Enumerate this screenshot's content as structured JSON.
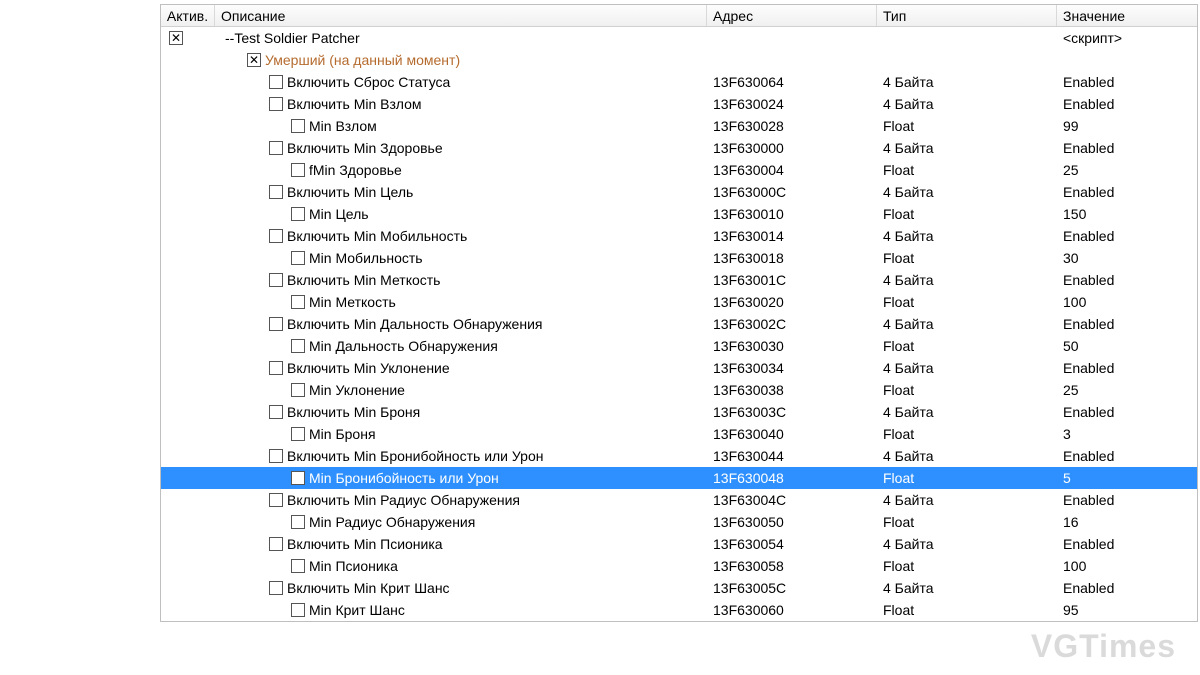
{
  "headers": {
    "active": "Актив.",
    "description": "Описание",
    "address": "Адрес",
    "type": "Тип",
    "value": "Значение"
  },
  "watermark": "VGTimes",
  "rows": [
    {
      "indent": 0,
      "checkboxInActive": true,
      "checked": true,
      "desc": "--Test Soldier Patcher",
      "addr": "",
      "type": "",
      "val": "<скрипт>",
      "special": false,
      "selected": false
    },
    {
      "indent": 1,
      "checkboxInActive": false,
      "checked": true,
      "desc": "Умерший (на данный момент)",
      "addr": "",
      "type": "",
      "val": "",
      "special": true,
      "selected": false
    },
    {
      "indent": 2,
      "checkboxInActive": false,
      "checked": false,
      "desc": "Включить Сброс Статуса",
      "addr": "13F630064",
      "type": "4 Байта",
      "val": "Enabled",
      "special": false,
      "selected": false
    },
    {
      "indent": 2,
      "checkboxInActive": false,
      "checked": false,
      "desc": "Включить Min Взлом",
      "addr": "13F630024",
      "type": "4 Байта",
      "val": "Enabled",
      "special": false,
      "selected": false
    },
    {
      "indent": 3,
      "checkboxInActive": false,
      "checked": false,
      "desc": "Min Взлом",
      "addr": "13F630028",
      "type": "Float",
      "val": "99",
      "special": false,
      "selected": false
    },
    {
      "indent": 2,
      "checkboxInActive": false,
      "checked": false,
      "desc": "Включить Min Здоровье",
      "addr": "13F630000",
      "type": "4 Байта",
      "val": "Enabled",
      "special": false,
      "selected": false
    },
    {
      "indent": 3,
      "checkboxInActive": false,
      "checked": false,
      "desc": "fMin Здоровье",
      "addr": "13F630004",
      "type": "Float",
      "val": "25",
      "special": false,
      "selected": false
    },
    {
      "indent": 2,
      "checkboxInActive": false,
      "checked": false,
      "desc": "Включить Min Цель",
      "addr": "13F63000C",
      "type": "4 Байта",
      "val": "Enabled",
      "special": false,
      "selected": false
    },
    {
      "indent": 3,
      "checkboxInActive": false,
      "checked": false,
      "desc": "Min Цель",
      "addr": "13F630010",
      "type": "Float",
      "val": "150",
      "special": false,
      "selected": false
    },
    {
      "indent": 2,
      "checkboxInActive": false,
      "checked": false,
      "desc": "Включить Min Мобильность",
      "addr": "13F630014",
      "type": "4 Байта",
      "val": "Enabled",
      "special": false,
      "selected": false
    },
    {
      "indent": 3,
      "checkboxInActive": false,
      "checked": false,
      "desc": "Min Мобильность",
      "addr": "13F630018",
      "type": "Float",
      "val": "30",
      "special": false,
      "selected": false
    },
    {
      "indent": 2,
      "checkboxInActive": false,
      "checked": false,
      "desc": "Включить Min Меткость",
      "addr": "13F63001C",
      "type": "4 Байта",
      "val": "Enabled",
      "special": false,
      "selected": false
    },
    {
      "indent": 3,
      "checkboxInActive": false,
      "checked": false,
      "desc": "Min Меткость",
      "addr": "13F630020",
      "type": "Float",
      "val": "100",
      "special": false,
      "selected": false
    },
    {
      "indent": 2,
      "checkboxInActive": false,
      "checked": false,
      "desc": "Включить Min Дальность Обнаружения",
      "addr": "13F63002C",
      "type": "4 Байта",
      "val": "Enabled",
      "special": false,
      "selected": false
    },
    {
      "indent": 3,
      "checkboxInActive": false,
      "checked": false,
      "desc": "Min Дальность Обнаружения",
      "addr": "13F630030",
      "type": "Float",
      "val": "50",
      "special": false,
      "selected": false
    },
    {
      "indent": 2,
      "checkboxInActive": false,
      "checked": false,
      "desc": "Включить Min Уклонение",
      "addr": "13F630034",
      "type": "4 Байта",
      "val": "Enabled",
      "special": false,
      "selected": false
    },
    {
      "indent": 3,
      "checkboxInActive": false,
      "checked": false,
      "desc": "Min Уклонение",
      "addr": "13F630038",
      "type": "Float",
      "val": "25",
      "special": false,
      "selected": false
    },
    {
      "indent": 2,
      "checkboxInActive": false,
      "checked": false,
      "desc": "Включить Min Броня",
      "addr": "13F63003C",
      "type": "4 Байта",
      "val": "Enabled",
      "special": false,
      "selected": false
    },
    {
      "indent": 3,
      "checkboxInActive": false,
      "checked": false,
      "desc": "Min Броня",
      "addr": "13F630040",
      "type": "Float",
      "val": "3",
      "special": false,
      "selected": false
    },
    {
      "indent": 2,
      "checkboxInActive": false,
      "checked": false,
      "desc": "Включить Min Бронибойность или Урон",
      "addr": "13F630044",
      "type": "4 Байта",
      "val": "Enabled",
      "special": false,
      "selected": false
    },
    {
      "indent": 3,
      "checkboxInActive": false,
      "checked": false,
      "desc": "Min Бронибойность или Урон",
      "addr": "13F630048",
      "type": "Float",
      "val": "5",
      "special": false,
      "selected": true
    },
    {
      "indent": 2,
      "checkboxInActive": false,
      "checked": false,
      "desc": "Включить Min Радиус Обнаружения",
      "addr": "13F63004C",
      "type": "4 Байта",
      "val": "Enabled",
      "special": false,
      "selected": false
    },
    {
      "indent": 3,
      "checkboxInActive": false,
      "checked": false,
      "desc": "Min Радиус Обнаружения",
      "addr": "13F630050",
      "type": "Float",
      "val": "16",
      "special": false,
      "selected": false
    },
    {
      "indent": 2,
      "checkboxInActive": false,
      "checked": false,
      "desc": "Включить Min Псионика",
      "addr": "13F630054",
      "type": "4 Байта",
      "val": "Enabled",
      "special": false,
      "selected": false
    },
    {
      "indent": 3,
      "checkboxInActive": false,
      "checked": false,
      "desc": "Min Псионика",
      "addr": "13F630058",
      "type": "Float",
      "val": "100",
      "special": false,
      "selected": false
    },
    {
      "indent": 2,
      "checkboxInActive": false,
      "checked": false,
      "desc": "Включить Min Крит Шанс",
      "addr": "13F63005C",
      "type": "4 Байта",
      "val": "Enabled",
      "special": false,
      "selected": false
    },
    {
      "indent": 3,
      "checkboxInActive": false,
      "checked": false,
      "desc": "Min Крит Шанс",
      "addr": "13F630060",
      "type": "Float",
      "val": "95",
      "special": false,
      "selected": false
    }
  ]
}
